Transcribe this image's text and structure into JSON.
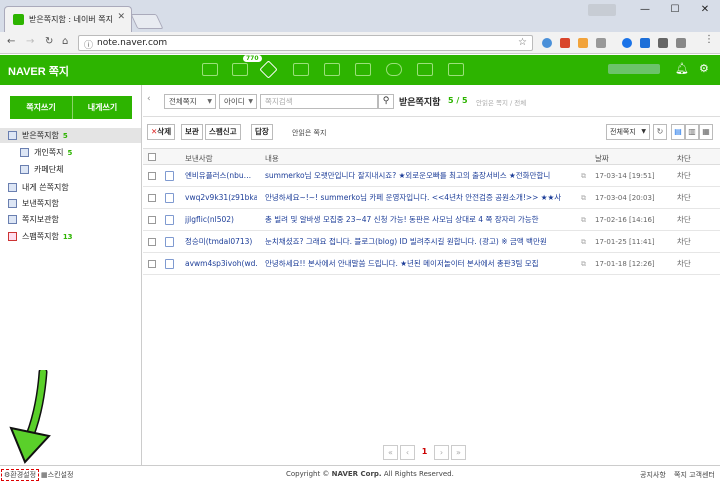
{
  "browser": {
    "tab_title": "받은쪽지함 : 네이버 쪽지",
    "url": "note.naver.com",
    "window_controls": [
      "—",
      "☐",
      "✕"
    ]
  },
  "gnb": {
    "logo": "NAVER 쪽지",
    "badge": "770",
    "brand_color": "#2db400"
  },
  "sidebar": {
    "write_button": "쪽지쓰기",
    "self_button": "내게쓰기",
    "items": [
      {
        "label": "받은쪽지함",
        "count": "5"
      },
      {
        "label": "개인쪽지",
        "count": "5"
      },
      {
        "label": "카페단체",
        "count": ""
      },
      {
        "label": "내게 쓴쪽지함",
        "count": ""
      },
      {
        "label": "보낸쪽지함",
        "count": ""
      },
      {
        "label": "쪽지보관함",
        "count": ""
      },
      {
        "label": "스팸쪽지함",
        "count": "13"
      }
    ]
  },
  "toolbar": {
    "filter_select": "전체쪽지",
    "field_select": "아이디",
    "search_placeholder": "쪽지검색",
    "box_title": "받은쪽지함",
    "box_count": "5 / 5",
    "box_desc": "안읽은 쪽지 / 전체",
    "delete_label": "삭제",
    "keep_label": "보관",
    "spam_label": "스팸신고",
    "reply_label": "답장",
    "unread_label": "안읽은 쪽지",
    "view_select": "전체쪽지"
  },
  "table": {
    "headers": [
      "보낸사람",
      "내용",
      "날짜",
      "차단"
    ],
    "rows": [
      {
        "sender": "엔비유플러스(nbu…",
        "content": "summerko님 오랫만입니다 잘지내시죠? ★외로운오빠를 최고의 출장서비스 ★전화만합니",
        "date": "17-03-14 [19:51]",
        "block": "차단"
      },
      {
        "sender": "vwq2v9k31(z91bka…",
        "content": "안녕하세요~!~! summerko님 카페 운영자입니다. <<4년차 안전검증 공원소개!>> ★★사",
        "date": "17-03-04 [20:03]",
        "block": "차단"
      },
      {
        "sender": "jjlgflic(nl502)",
        "content": "총 빌려 및 알바생 모집중 23~47 신청 가능! 동판은 사모님 상대로 4 쪽 장자리 가능한",
        "date": "17-02-16 [14:16]",
        "block": "차단"
      },
      {
        "sender": "정승미(tmdal0713)",
        "content": "눈치채셨죠? 그래요 접니다. 블로그(blog) ID 빌려주시길 원합니다. (광고) ※ 금액 백만원",
        "date": "17-01-25 [11:41]",
        "block": "차단"
      },
      {
        "sender": "avwm4sp3ivoh(wd…",
        "content": "안녕하세요!! 본사에서 안내말씀 드립니다. ★년된 메이저놀이터 본사에서 총판3팀 모집",
        "date": "17-01-18 [12:26]",
        "block": "차단"
      }
    ]
  },
  "pager": {
    "current": "1"
  },
  "footer": {
    "env_label": "환경설정",
    "skin_label": "스킨설정",
    "copyright_prefix": "Copyright ©",
    "company": "NAVER Corp.",
    "rights": "All Rights Reserved.",
    "notice": "공지사항",
    "help": "쪽지 고객센터"
  }
}
